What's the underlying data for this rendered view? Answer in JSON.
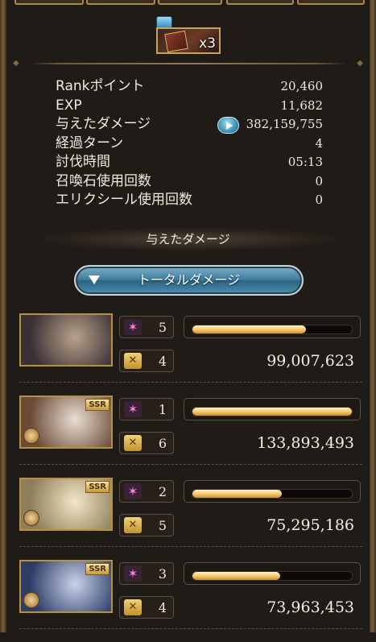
{
  "drop": {
    "quantity": "x3"
  },
  "stats": [
    {
      "label": "Rankポイント",
      "value": "20,460"
    },
    {
      "label": "EXP",
      "value": "11,682"
    },
    {
      "label": "与えたダメージ",
      "value": "382,159,755"
    },
    {
      "label": "経過ターン",
      "value": "4"
    },
    {
      "label": "討伐時間",
      "value": "05:13"
    },
    {
      "label": "召喚石使用回数",
      "value": "0"
    },
    {
      "label": "エリクシール使用回数",
      "value": "0"
    }
  ],
  "damage_section": {
    "title": "与えたダメージ",
    "sort_button_label": "トータルダメージ"
  },
  "characters": [
    {
      "stat1": "5",
      "stat2": "4",
      "damage": "99,007,623",
      "bar_fill_fraction": 0.71,
      "rarity": "",
      "art_colors": [
        "#3a2f35",
        "#b8a38a"
      ]
    },
    {
      "stat1": "1",
      "stat2": "6",
      "damage": "133,893,493",
      "bar_fill_fraction": 1.0,
      "rarity": "SSR",
      "art_colors": [
        "#6b4a36",
        "#e8dfd3"
      ]
    },
    {
      "stat1": "2",
      "stat2": "5",
      "damage": "75,295,186",
      "bar_fill_fraction": 0.56,
      "rarity": "SSR",
      "art_colors": [
        "#8f7e5c",
        "#f2e7c7"
      ]
    },
    {
      "stat1": "3",
      "stat2": "4",
      "damage": "73,963,453",
      "bar_fill_fraction": 0.55,
      "rarity": "SSR",
      "art_colors": [
        "#2e3c66",
        "#c9d3ea"
      ]
    }
  ],
  "colors": {
    "background": "#1f1b17",
    "text": "#f0eadc",
    "bar_fill": "#f2c569",
    "button": "#3d7d9e"
  }
}
